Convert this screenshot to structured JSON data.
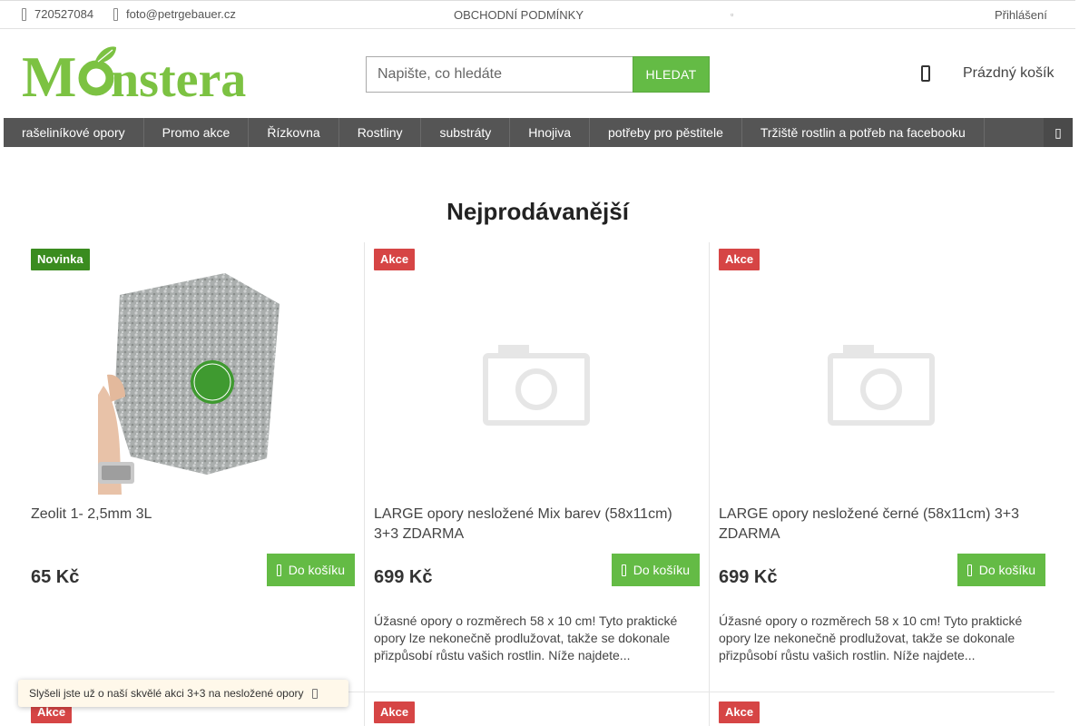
{
  "topbar": {
    "phone": "720527084",
    "email": "foto@petrgebauer.cz",
    "terms": "OBCHODNÍ PODMÍNKY",
    "login": "Přihlášení"
  },
  "logo": {
    "text": "Monstera",
    "color": "#7cc242"
  },
  "search": {
    "placeholder": "Napište, co hledáte",
    "button": "HLEDAT"
  },
  "cart": {
    "label": "Prázdný košík"
  },
  "nav": {
    "items": [
      "rašeliníkové opory",
      "Promo akce",
      "Řízkovna",
      "Rostliny",
      "substráty",
      "Hnojiva",
      "potřeby pro pěstitele",
      "Tržiště rostlin a potřeb na facebooku"
    ]
  },
  "section_title": "Nejprodávanější",
  "products": [
    {
      "badge": "Novinka",
      "name": "Zeolit 1- 2,5mm 3L",
      "price": "65 Kč",
      "button": "Do košíku",
      "desc": ""
    },
    {
      "badge": "Akce",
      "name": "LARGE opory nesložené Mix barev (58x11cm) 3+3 ZDARMA",
      "price": "699 Kč",
      "button": "Do košíku",
      "desc": "Úžasné opory o rozměrech 58 x 10 cm! Tyto praktické opory lze nekonečně prodlužovat, takže se dokonale přizpůsobí růstu vašich rostlin. Níže najdete..."
    },
    {
      "badge": "Akce",
      "name": "LARGE opory nesložené černé (58x11cm) 3+3 ZDARMA",
      "price": "699 Kč",
      "button": "Do košíku",
      "desc": "Úžasné opory o rozměrech 58 x 10 cm! Tyto praktické opory lze nekonečně prodlužovat, takže se dokonale přizpůsobí růstu vašich rostlin. Níže najdete..."
    }
  ],
  "row2_badges": [
    "Akce",
    "Akce",
    "Akce"
  ],
  "toast": {
    "text": "Slyšeli jste už o naší skvělé akci 3+3 na nesložené opory"
  },
  "colors": {
    "accent": "#64bb45",
    "nav": "#555555",
    "sale": "#d64545",
    "new": "#3a8c1f"
  }
}
